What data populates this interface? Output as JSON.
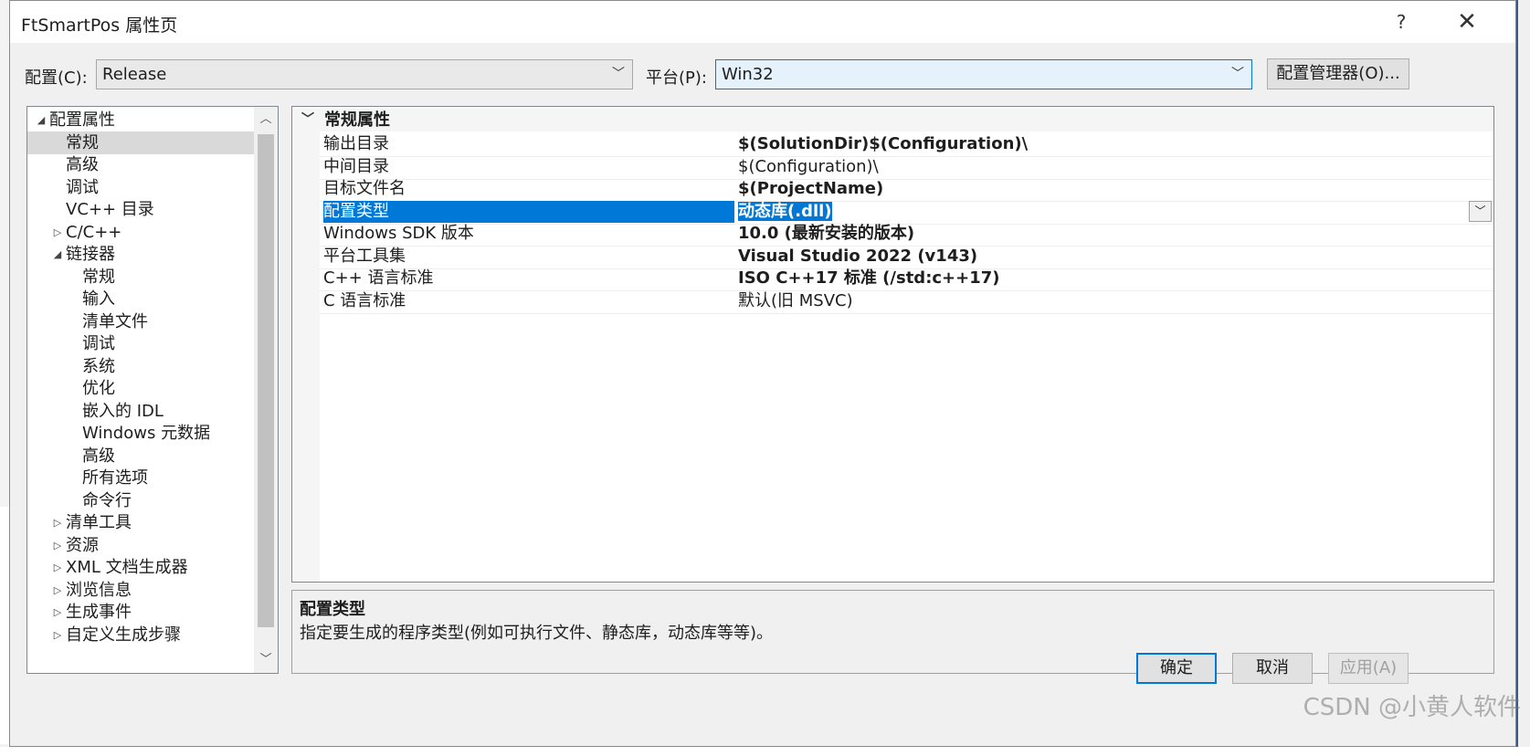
{
  "window": {
    "title": "FtSmartPos 属性页",
    "help_label": "?",
    "close_label": "✕"
  },
  "config": {
    "label": "配置(C):",
    "value": "Release"
  },
  "platform": {
    "label": "平台(P):",
    "value": "Win32"
  },
  "config_manager_label": "配置管理器(O)...",
  "tree": {
    "items": [
      {
        "label": "配置属性",
        "level": 0,
        "expander": "◢"
      },
      {
        "label": "常规",
        "level": 1,
        "expander": ""
      },
      {
        "label": "高级",
        "level": 1,
        "expander": ""
      },
      {
        "label": "调试",
        "level": 1,
        "expander": ""
      },
      {
        "label": "VC++ 目录",
        "level": 1,
        "expander": ""
      },
      {
        "label": "C/C++",
        "level": 1,
        "expander": "▷"
      },
      {
        "label": "链接器",
        "level": 1,
        "expander": "◢"
      },
      {
        "label": "常规",
        "level": 2,
        "expander": ""
      },
      {
        "label": "输入",
        "level": 2,
        "expander": ""
      },
      {
        "label": "清单文件",
        "level": 2,
        "expander": ""
      },
      {
        "label": "调试",
        "level": 2,
        "expander": ""
      },
      {
        "label": "系统",
        "level": 2,
        "expander": ""
      },
      {
        "label": "优化",
        "level": 2,
        "expander": ""
      },
      {
        "label": "嵌入的 IDL",
        "level": 2,
        "expander": ""
      },
      {
        "label": "Windows 元数据",
        "level": 2,
        "expander": ""
      },
      {
        "label": "高级",
        "level": 2,
        "expander": ""
      },
      {
        "label": "所有选项",
        "level": 2,
        "expander": ""
      },
      {
        "label": "命令行",
        "level": 2,
        "expander": ""
      },
      {
        "label": "清单工具",
        "level": 1,
        "expander": "▷"
      },
      {
        "label": "资源",
        "level": 1,
        "expander": "▷"
      },
      {
        "label": "XML 文档生成器",
        "level": 1,
        "expander": "▷"
      },
      {
        "label": "浏览信息",
        "level": 1,
        "expander": "▷"
      },
      {
        "label": "生成事件",
        "level": 1,
        "expander": "▷"
      },
      {
        "label": "自定义生成步骤",
        "level": 1,
        "expander": "▷"
      }
    ],
    "selected_index": 1
  },
  "grid": {
    "category": "常规属性",
    "rows": [
      {
        "name": "输出目录",
        "value": "$(SolutionDir)$(Configuration)\\",
        "bold": true
      },
      {
        "name": "中间目录",
        "value": "$(Configuration)\\",
        "bold": false
      },
      {
        "name": "目标文件名",
        "value": "$(ProjectName)",
        "bold": true
      },
      {
        "name": "配置类型",
        "value": "动态库(.dll)",
        "bold": true
      },
      {
        "name": "Windows SDK 版本",
        "value": "10.0 (最新安装的版本)",
        "bold": true
      },
      {
        "name": "平台工具集",
        "value": "Visual Studio 2022 (v143)",
        "bold": true
      },
      {
        "name": "C++ 语言标准",
        "value": "ISO C++17 标准 (/std:c++17)",
        "bold": true
      },
      {
        "name": "C 语言标准",
        "value": "默认(旧 MSVC)",
        "bold": false
      }
    ],
    "selected_index": 3
  },
  "description": {
    "title": "配置类型",
    "text": "指定要生成的程序类型(例如可执行文件、静态库，动态库等等)。"
  },
  "buttons": {
    "ok": "确定",
    "cancel": "取消",
    "apply": "应用(A)"
  },
  "watermark": "CSDN @小黄人软件",
  "colors": {
    "accent": "#0078d7",
    "dialog_bg": "#f0f0f0"
  },
  "icons": {
    "tree_scroll_up": "chevron-up-icon",
    "tree_scroll_down": "chevron-down-icon",
    "dropdown": "chevron-down-icon"
  }
}
